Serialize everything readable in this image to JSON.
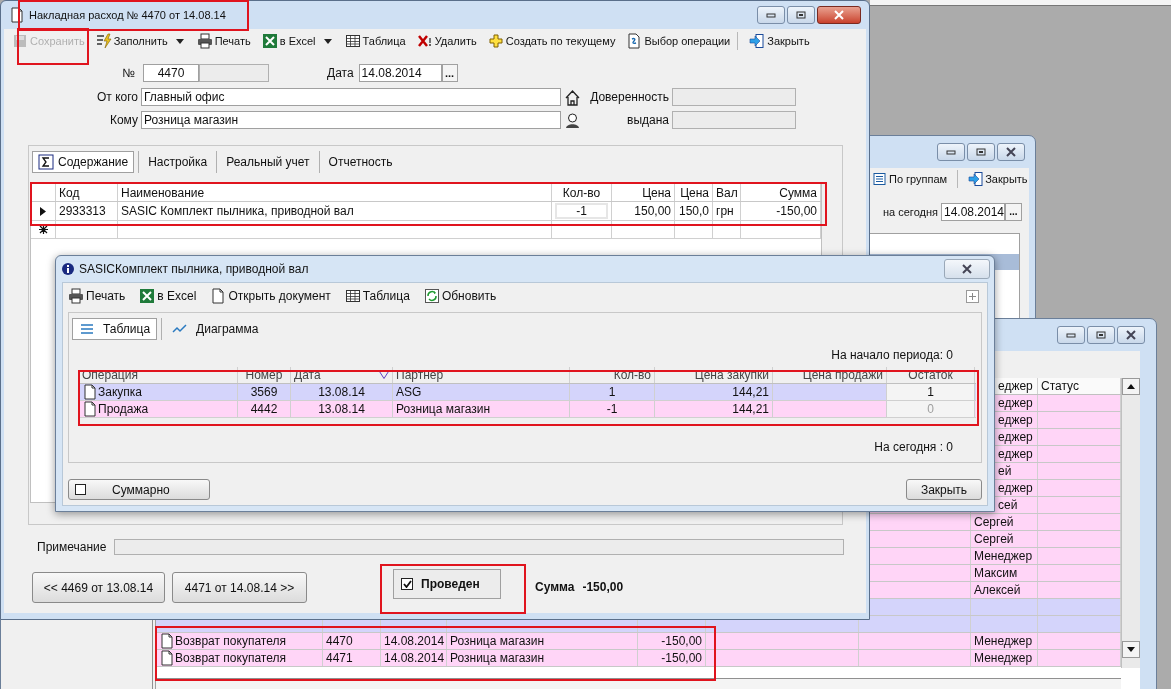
{
  "main_window": {
    "title": "Накладная расход № 4470 от 14.08.14",
    "toolbar": [
      {
        "label": "Сохранить",
        "disabled": true,
        "dropdown": false
      },
      {
        "label": "Заполнить",
        "disabled": false,
        "dropdown": true
      },
      {
        "label": "Печать",
        "disabled": false,
        "dropdown": false
      },
      {
        "label": "в Excel",
        "disabled": false,
        "dropdown": true
      },
      {
        "label": "Таблица",
        "disabled": false,
        "dropdown": false
      },
      {
        "label": "Удалить",
        "disabled": false,
        "dropdown": false
      },
      {
        "label": "Создать по текущему",
        "disabled": false,
        "dropdown": false
      },
      {
        "label": "Выбор операции",
        "disabled": false,
        "dropdown": false
      },
      {
        "label": "Закрыть",
        "disabled": false,
        "dropdown": false
      }
    ],
    "number_label": "№",
    "number": "4470",
    "date_label": "Дата",
    "date": "14.08.2014",
    "date_button": "...",
    "from_label": "От кого",
    "from": "Главный офис",
    "to_label": "Кому",
    "to": "Розница магазин",
    "proxy_label": "Доверенность",
    "issued_label": "выдана",
    "tabs": [
      {
        "label": "Содержание",
        "selected": true
      },
      {
        "label": "Настройка",
        "selected": false
      },
      {
        "label": "Реальный учет",
        "selected": false
      },
      {
        "label": "Отчетность",
        "selected": false
      }
    ],
    "grid": {
      "columns": [
        "Код",
        "Наименование",
        "Кол-во",
        "Цена",
        "Цена",
        "Вал",
        "Сумма"
      ],
      "rows": [
        {
          "code": "2933313",
          "name": "SASIC Комплект пылника, приводной вал",
          "qty": "-1",
          "price": "150,00",
          "price_2": "150,0",
          "currency": "грн",
          "sum": "-150,00",
          "current": true
        }
      ]
    },
    "note_label": "Примечание",
    "prev_button": "<< 4469 от 13.08.14",
    "next_button": "4471 от 14.08.14 >>",
    "posted": {
      "label": "Проведен",
      "checked": true
    },
    "total_label": "Сумма",
    "total": "-150,00"
  },
  "dialog": {
    "title": "SASICКомплект пылника, приводной вал",
    "toolbar": [
      "Печать",
      "в Excel",
      "Открыть документ",
      "Таблица",
      "Обновить"
    ],
    "tabs": [
      {
        "label": "Таблица",
        "selected": true
      },
      {
        "label": "Диаграмма",
        "selected": false
      }
    ],
    "period_start": "На начало периода: 0",
    "columns": [
      "Операция",
      "Номер",
      "Дата",
      "Партнер",
      "Кол-во",
      "Цена закупки",
      "Цена продажи",
      "Остаток"
    ],
    "rows": [
      {
        "operation": "Закупка",
        "number": "3569",
        "date": "13.08.14",
        "partner": "ASG",
        "qty": "1",
        "buy_price": "144,21",
        "balance": "1",
        "balance_dimmed": false,
        "color": "#d4d4fb"
      },
      {
        "operation": "Продажа",
        "number": "4442",
        "date": "13.08.14",
        "partner": "Розница магазин",
        "qty": "-1",
        "buy_price": "144,21",
        "balance": "0",
        "balance_dimmed": true,
        "color": "#ffd5f7"
      }
    ],
    "today": "На сегодня : 0",
    "summary": {
      "label": "Суммарно",
      "checked": false
    },
    "close_button": "Закрыть"
  },
  "groups_window": {
    "toolbar": [
      "По группам",
      "Закрыть"
    ],
    "today_label": "на сегодня",
    "date": "14.08.2014",
    "date_button": "..."
  },
  "list_window": {
    "header": {
      "manager": "еджер",
      "status": "Статус",
      "clipped": true
    },
    "rows": [
      {
        "manager": "еджер",
        "clipped": true,
        "color": "#ffd5f7"
      },
      {
        "manager": "еджер",
        "clipped": true,
        "color": "#ffd5f7"
      },
      {
        "manager": "еджер",
        "clipped": true,
        "color": "#ffd5f7"
      },
      {
        "manager": "еджер",
        "clipped": true,
        "color": "#ffd5f7"
      },
      {
        "manager": "ей",
        "clipped": true,
        "color": "#ffd5f7"
      },
      {
        "manager": "еджер",
        "clipped": true,
        "color": "#ffd5f7"
      },
      {
        "manager": "сей",
        "clipped": true,
        "color": "#ffd5f7"
      },
      {
        "manager": "Сергей",
        "clipped": false,
        "color": "#ffd5f7"
      },
      {
        "manager": "Сергей",
        "clipped": false,
        "color": "#ffd5f7"
      },
      {
        "manager": "Менеджер",
        "clipped": false,
        "color": "#ffd5f7"
      },
      {
        "manager": "Максим",
        "clipped": false,
        "color": "#ffd5f7"
      },
      {
        "manager": "Алексей",
        "clipped": false,
        "color": "#ffd5f7"
      },
      {
        "color": "#d4d4fb"
      },
      {
        "color": "#d4d4fb"
      },
      {
        "type": "Возврат покупателя",
        "number": "4470",
        "date": "14.08.2014",
        "partner": "Розница магазин",
        "sum": "-150,00",
        "manager": "Менеджер",
        "clipped": false,
        "color": "#ffd5f7"
      },
      {
        "type": "Возврат покупателя",
        "number": "4471",
        "date": "14.08.2014",
        "partner": "Розница магазин",
        "sum": "-150,00",
        "manager": "Менеджер",
        "clipped": false,
        "color": "#ffd5f7"
      }
    ]
  }
}
